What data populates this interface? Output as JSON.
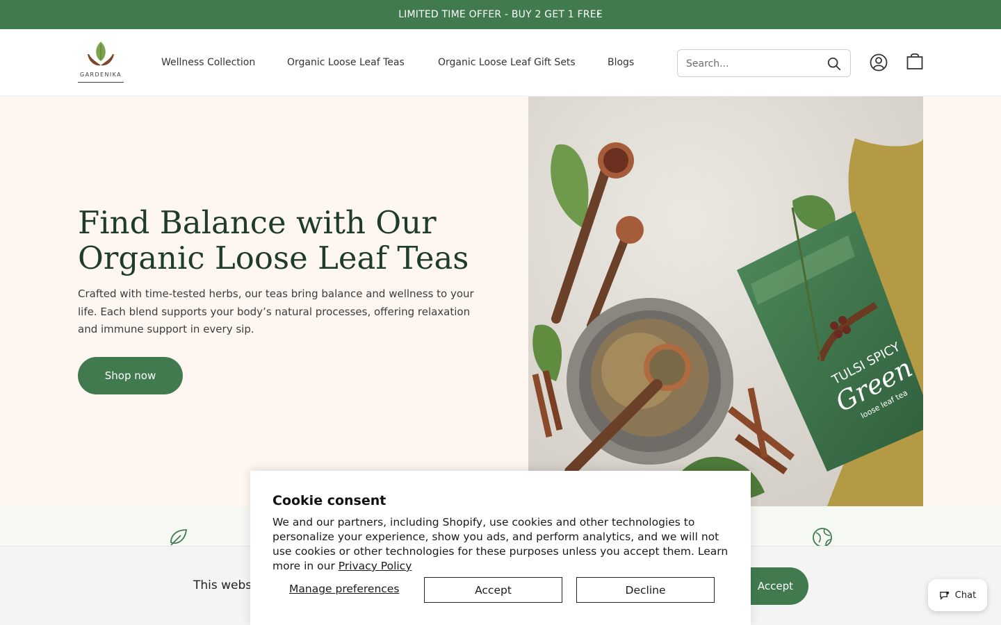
{
  "announcement": {
    "text": "LIMITED TIME OFFER - BUY 2 GET 1 FREE",
    "arrow": "›"
  },
  "header": {
    "brand": "GARDENIKA",
    "nav": [
      "Wellness Collection",
      "Organic Loose Leaf Teas",
      "Organic Loose Leaf Gift Sets",
      "Blogs"
    ],
    "search_placeholder": "Search...",
    "icons": [
      "search-icon",
      "account-icon",
      "cart-icon"
    ]
  },
  "hero": {
    "title": "Find Balance with Our Organic Loose Leaf Teas",
    "subtitle": "Crafted with time-tested herbs, our teas bring balance and wellness to your life. Each blend supports your body’s natural processes, offering relaxation and immune support in every sip.",
    "cta": "Shop now",
    "image_icon": "tea-product-photo",
    "package_label_1": "TULSI SPICY",
    "package_label_2": "Green",
    "package_label_3": "loose leaf tea"
  },
  "features": {
    "icons": [
      "leaf-icon",
      "globe-icon"
    ]
  },
  "privacy_banner": {
    "text": "This websi",
    "accept": "Accept"
  },
  "chat": {
    "label": "Chat"
  },
  "cookie": {
    "title": "Cookie consent",
    "body": "We and our partners, including Shopify, use cookies and other technologies to personalize your experience, show you ads, and perform analytics, and we will not use cookies or other technologies for these purposes unless you accept them. Learn more in our ",
    "policy_link": "Privacy Policy",
    "manage": "Manage preferences",
    "accept": "Accept",
    "decline": "Decline"
  },
  "colors": {
    "brand_green": "#417A4E",
    "hero_bg": "#FEF7F1",
    "title_color": "#1E3B2B"
  }
}
